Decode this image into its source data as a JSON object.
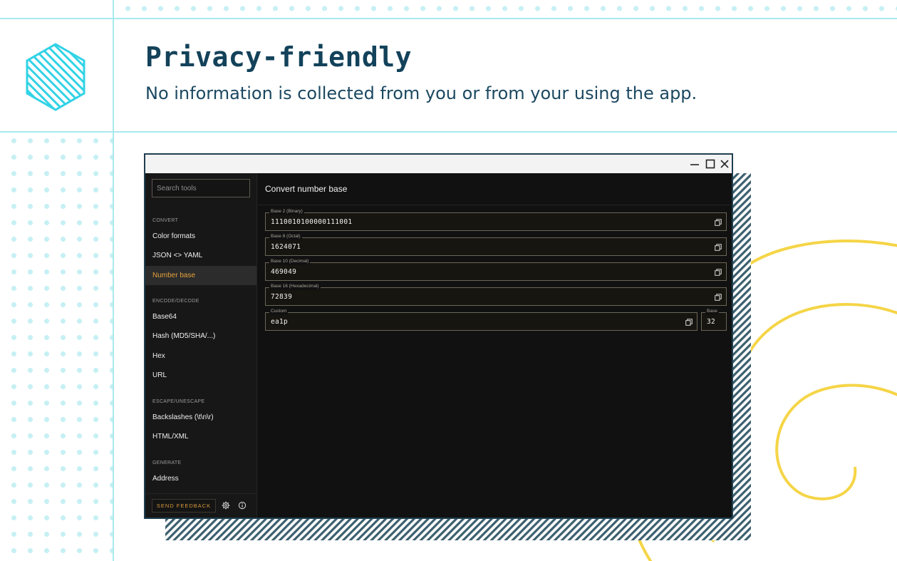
{
  "hero": {
    "title": "Privacy-friendly",
    "subtitle": "No information is collected from you or from your using the app."
  },
  "window_controls": {
    "icons": [
      "minimize-icon",
      "maximize-icon",
      "close-icon"
    ]
  },
  "sidebar": {
    "search_placeholder": "Search tools",
    "sections": [
      {
        "title": "CONVERT",
        "items": [
          "Color formats",
          "JSON <> YAML",
          "Number base"
        ]
      },
      {
        "title": "ENCODE/DECODE",
        "items": [
          "Base64",
          "Hash (MD5/SHA/...)",
          "Hex",
          "URL"
        ]
      },
      {
        "title": "ESCAPE/UNESCAPE",
        "items": [
          "Backslashes (\\t\\n\\r)",
          "HTML/XML"
        ]
      },
      {
        "title": "GENERATE",
        "items": [
          "Address"
        ]
      }
    ],
    "active_item": "Number base",
    "feedback_label": "SEND FEEDBACK",
    "footer_icons": [
      "gear-icon",
      "info-icon"
    ]
  },
  "main": {
    "title": "Convert number base",
    "fields": [
      {
        "label": "Base 2 (Binary)",
        "value": "1110010100000111001"
      },
      {
        "label": "Base 8 (Octal)",
        "value": "1624071"
      },
      {
        "label": "Base 10 (Decimal)",
        "value": "469049"
      },
      {
        "label": "Base 16 (Hexadecimal)",
        "value": "72839"
      },
      {
        "label": "Custom",
        "value": "ea1p"
      }
    ],
    "base_field": {
      "label": "Base",
      "value": "32"
    }
  },
  "colors": {
    "brand_dark": "#13425a",
    "grid_cyan": "#a9e9ef",
    "hex_cyan": "#31d3e6",
    "accent_orange": "#e6a23c",
    "swirl_yellow": "#f5d547",
    "window_bg": "#111111",
    "sidebar_bg": "#171717"
  }
}
